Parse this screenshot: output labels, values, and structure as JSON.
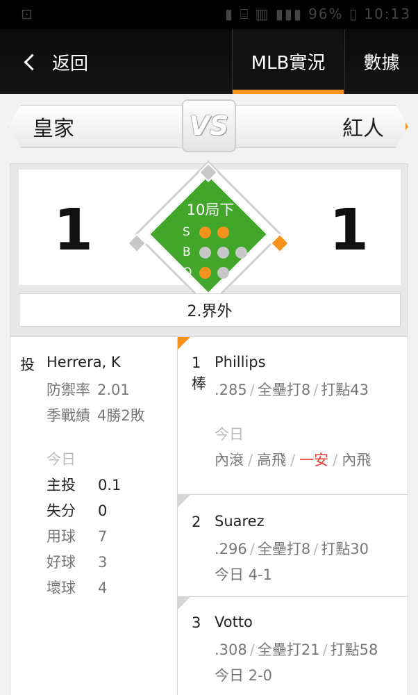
{
  "status_bar": {
    "left_text": "⊡",
    "right_text": "▮ ⌸ ▥ ▮▮▮ 96% ▯ 10:13"
  },
  "nav": {
    "back_label": "返回",
    "tabs": [
      {
        "label": "MLB實況",
        "active": true
      },
      {
        "label": "數據",
        "active": false
      }
    ]
  },
  "matchup": {
    "home_team": "皇家",
    "vs_label": "VS",
    "away_team": "紅人"
  },
  "scoreboard": {
    "home_score": "1",
    "away_score": "1",
    "inning": "10局下",
    "count": {
      "balls_label": "B",
      "strikes_label": "S",
      "outs_label": "O",
      "strikes": 2,
      "balls": 0,
      "outs": 1
    },
    "bases": {
      "first": true,
      "second": false,
      "third": false
    },
    "play_result": "2.界外"
  },
  "pitcher": {
    "role": "投",
    "name": "Herrera, K",
    "era_label": "防禦率",
    "era": "2.01",
    "record_label": "季戰績",
    "record": "4勝2敗",
    "today_label": "今日",
    "today_stats": [
      {
        "label": "主投",
        "value": "0.1",
        "emphasis": true
      },
      {
        "label": "失分",
        "value": "0",
        "emphasis": true
      },
      {
        "label": "用球",
        "value": "7",
        "emphasis": false
      },
      {
        "label": "好球",
        "value": "3",
        "emphasis": false
      },
      {
        "label": "壞球",
        "value": "4",
        "emphasis": false
      }
    ]
  },
  "batters": [
    {
      "order": "1",
      "order_suffix": "棒",
      "name": "Phillips",
      "avg": ".285",
      "hr": "全壘打8",
      "rbi": "打點43",
      "today_label": "今日",
      "today_results": [
        "內滾",
        "高飛",
        "一安",
        "內飛"
      ],
      "hit_index": 2,
      "active": true
    },
    {
      "order": "2",
      "name": "Suarez",
      "avg": ".296",
      "hr": "全壘打8",
      "rbi": "打點30",
      "today": "今日 4-1",
      "active": false
    },
    {
      "order": "3",
      "name": "Votto",
      "avg": ".308",
      "hr": "全壘打21",
      "rbi": "打點58",
      "today": "今日 2-0",
      "active": false
    }
  ],
  "colors": {
    "accent": "#f6921e",
    "field": "#41a62a",
    "hit": "#e63b2e"
  }
}
